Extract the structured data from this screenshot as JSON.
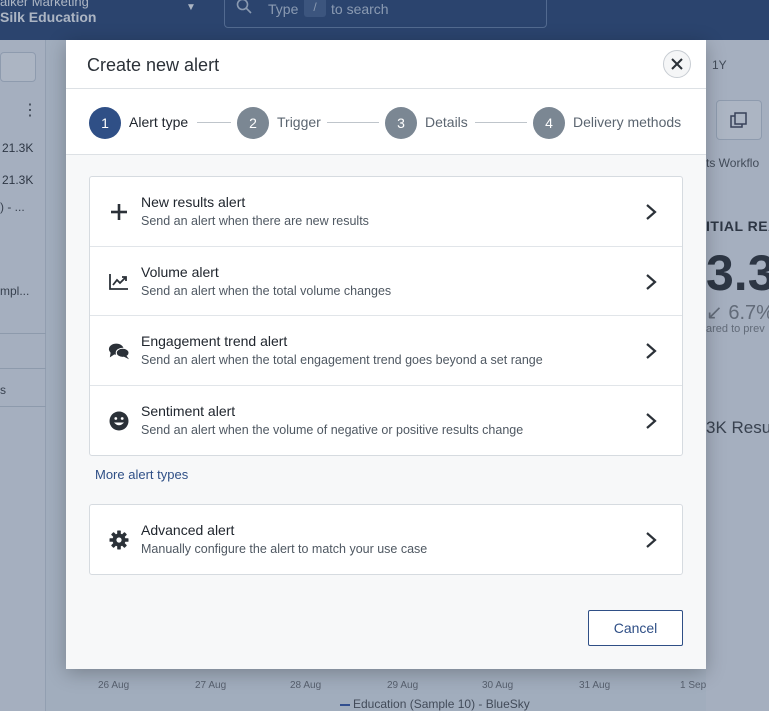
{
  "background": {
    "org_line1": "aiker Marketing",
    "org_line2": "Silk Education",
    "search_prefix": "Type",
    "search_key": "/",
    "search_suffix": "to search",
    "side_num1": "21.3K",
    "side_num2": "21.3K",
    "side_text1": ") - ...",
    "side_text2": "mpl...",
    "side_text3": "s",
    "range_label": "1Y",
    "tabs_text": "ts  Workflo",
    "panel_heading": "ITIAL REA",
    "big_value": "3.3",
    "pct_value": "↙ 6.7%",
    "compared_text": "ared to prev",
    "results_text": "3K Resu",
    "x_ticks": [
      "26 Aug",
      "27 Aug",
      "28 Aug",
      "29 Aug",
      "30 Aug",
      "31 Aug",
      "1 Sep"
    ],
    "legend": "Education (Sample 10) - BlueSky"
  },
  "modal": {
    "title": "Create new alert",
    "steps": [
      {
        "number": "1",
        "label": "Alert type",
        "active": true
      },
      {
        "number": "2",
        "label": "Trigger",
        "active": false
      },
      {
        "number": "3",
        "label": "Details",
        "active": false
      },
      {
        "number": "4",
        "label": "Delivery methods",
        "active": false
      }
    ],
    "alert_types": [
      {
        "icon": "plus-icon",
        "title": "New results alert",
        "description": "Send an alert when there are new results"
      },
      {
        "icon": "trending-chart-icon",
        "title": "Volume alert",
        "description": "Send an alert when the total volume changes"
      },
      {
        "icon": "chat-bubbles-icon",
        "title": "Engagement trend alert",
        "description": "Send an alert when the total engagement trend goes beyond a set range"
      },
      {
        "icon": "smiley-face-icon",
        "title": "Sentiment alert",
        "description": "Send an alert when the volume of negative or positive results change"
      }
    ],
    "more_link": "More alert types",
    "advanced": {
      "icon": "gear-icon",
      "title": "Advanced alert",
      "description": "Manually configure the alert to match your use case"
    },
    "cancel_label": "Cancel"
  },
  "colors": {
    "primary": "#2f4f86",
    "step_active": "#2f4f86",
    "step_inactive": "#7b8793",
    "overlay": "#243c60"
  }
}
